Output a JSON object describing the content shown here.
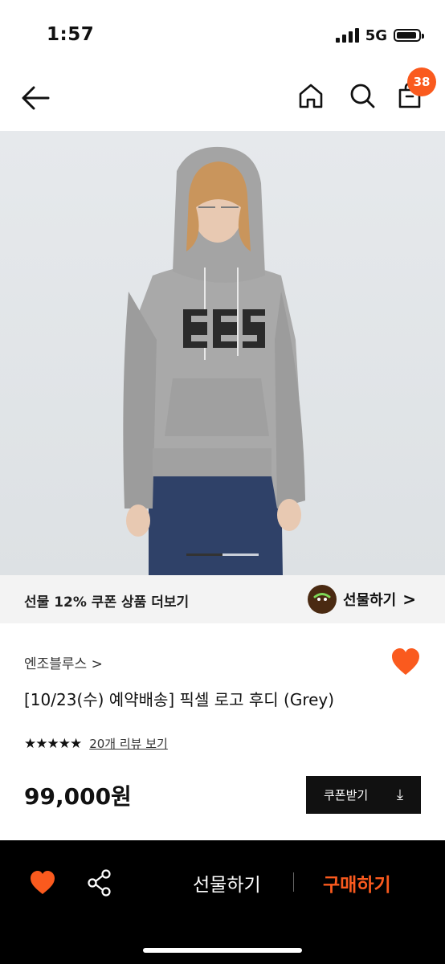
{
  "status": {
    "time": "1:57",
    "network": "5G"
  },
  "header": {
    "cart_count": "38"
  },
  "coupon_strip": {
    "text": "선물 12% 쿠폰 상품 더보기",
    "gift_link": "선물하기",
    "gift_chevron": ">"
  },
  "product": {
    "brand": "엔조블루스 >",
    "title": "[10/23(수) 예약배송] 픽셀 로고 후디 (Grey)",
    "stars": "★★★★★",
    "review_link": "20개 리뷰 보기",
    "price": "99,000원",
    "coupon_button": "쿠폰받기",
    "coupon_icon": "⤓"
  },
  "bottom_bar": {
    "gift_label": "선물하기",
    "buy_label": "구매하기"
  },
  "carousel": {
    "current_index": 2,
    "total": 2
  },
  "colors": {
    "accent": "#fa5a1e",
    "dark": "#111111"
  }
}
